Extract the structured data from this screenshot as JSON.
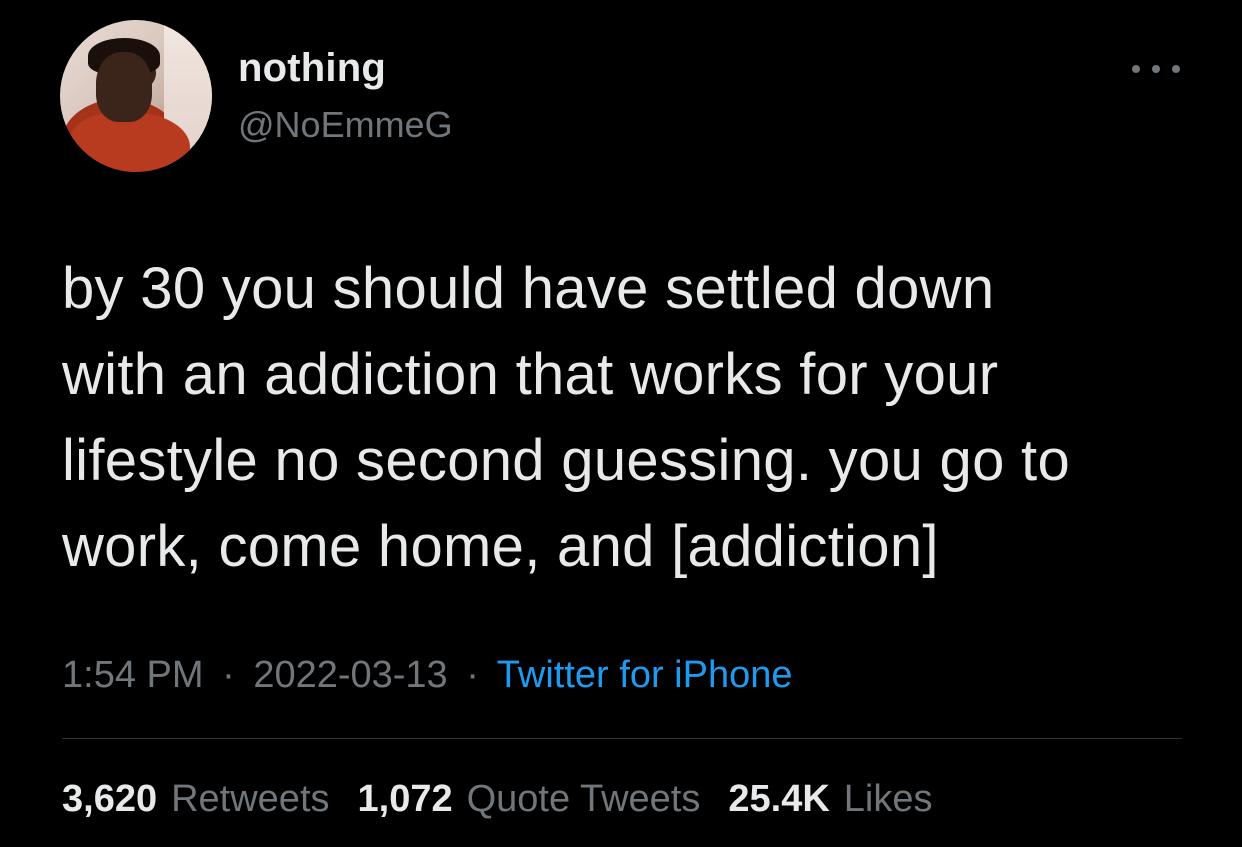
{
  "user": {
    "display_name": "nothing",
    "handle": "@NoEmmeG",
    "avatar_icon": "profile-photo"
  },
  "menu": {
    "icon": "more-horizontal-icon"
  },
  "tweet": {
    "lines": [
      "by 30 you should have settled down",
      "with an addiction that works for your",
      "lifestyle no second guessing. you go to",
      "work, come home, and [addiction]"
    ]
  },
  "meta": {
    "time": "1:54 PM",
    "separator": "·",
    "date": "2022-03-13",
    "source": "Twitter for iPhone"
  },
  "stats": {
    "retweets_count": "3,620",
    "retweets_label": "Retweets",
    "quotes_count": "1,072",
    "quotes_label": "Quote Tweets",
    "likes_count": "25.4K",
    "likes_label": "Likes"
  },
  "colors": {
    "background": "#000000",
    "primary_text": "#e7e9ea",
    "secondary_text": "#71767b",
    "link": "#1d9bf0",
    "divider": "#2f3336"
  }
}
